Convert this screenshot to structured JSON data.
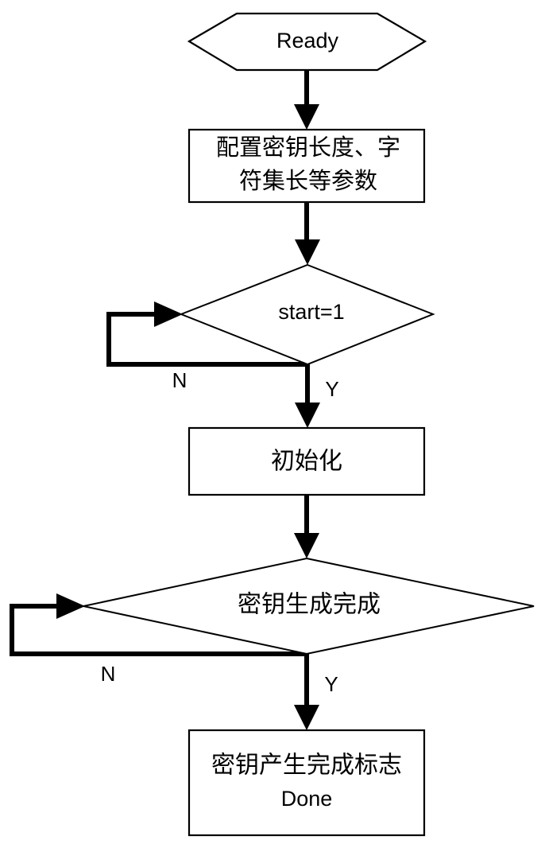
{
  "diagram": {
    "title": "Key generation flowchart",
    "type": "flowchart",
    "background_color": "#ffffff",
    "stroke_color": "#000000",
    "nodes": [
      {
        "id": "ready",
        "shape": "hexagon",
        "label": "Ready",
        "script": "latin"
      },
      {
        "id": "config",
        "shape": "rectangle",
        "label_line1": "配置密钥长度、字",
        "label_line2": "符集长等参数",
        "script": "cjk"
      },
      {
        "id": "start-check",
        "shape": "diamond",
        "label": "start=1",
        "script": "latin"
      },
      {
        "id": "init",
        "shape": "rectangle",
        "label": "初始化",
        "script": "cjk"
      },
      {
        "id": "keygen-check",
        "shape": "diamond",
        "label": "密钥生成完成",
        "script": "cjk"
      },
      {
        "id": "done",
        "shape": "rectangle",
        "label_line1": "密钥产生完成标志",
        "label_line2": "Done",
        "script": "mixed"
      }
    ],
    "edge_labels": {
      "start_no": "N",
      "start_yes": "Y",
      "keygen_no": "N",
      "keygen_yes": "Y"
    }
  }
}
